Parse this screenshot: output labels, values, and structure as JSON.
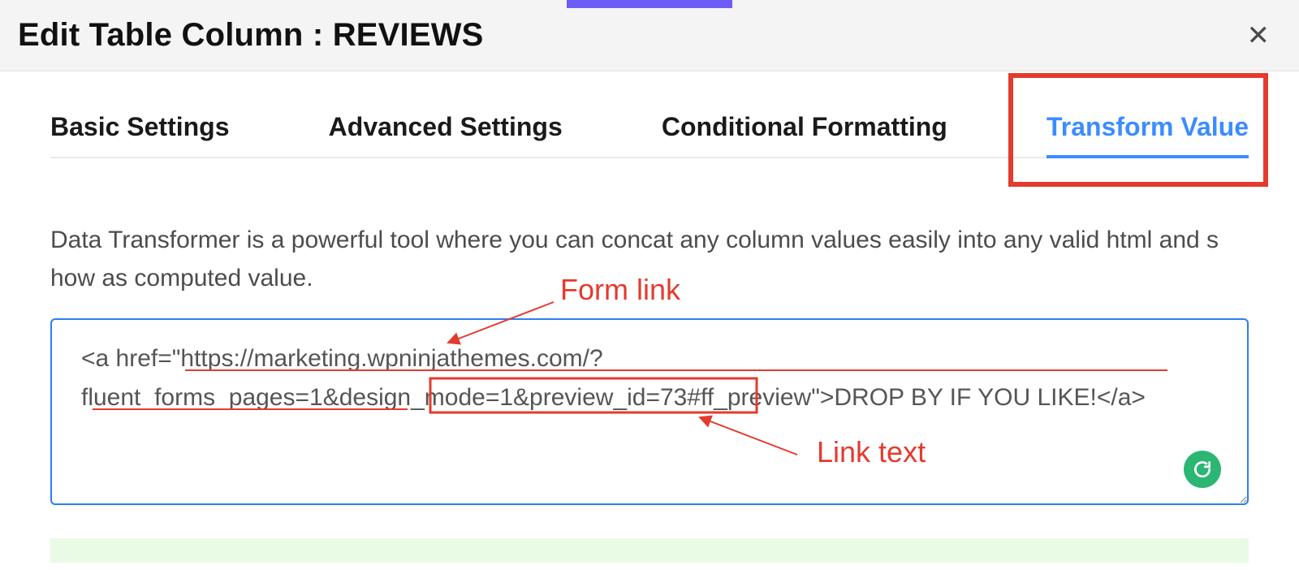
{
  "header": {
    "title": "Edit Table Column : REVIEWS"
  },
  "tabs": {
    "items": [
      {
        "label": "Basic Settings"
      },
      {
        "label": "Advanced Settings"
      },
      {
        "label": "Conditional Formatting"
      },
      {
        "label": "Transform Value"
      }
    ],
    "active_index": 3
  },
  "transform": {
    "description": "Data Transformer is a powerful tool where you can concat any column values easily into any valid html and show as computed value.",
    "value": "<a href=\"https://marketing.wpninjathemes.com/?fluent_forms_pages=1&design_mode=1&preview_id=73#ff_preview\">DROP BY IF YOU LIKE!</a>"
  },
  "annotations": {
    "form_link_label": "Form link",
    "link_text_label": "Link text"
  }
}
